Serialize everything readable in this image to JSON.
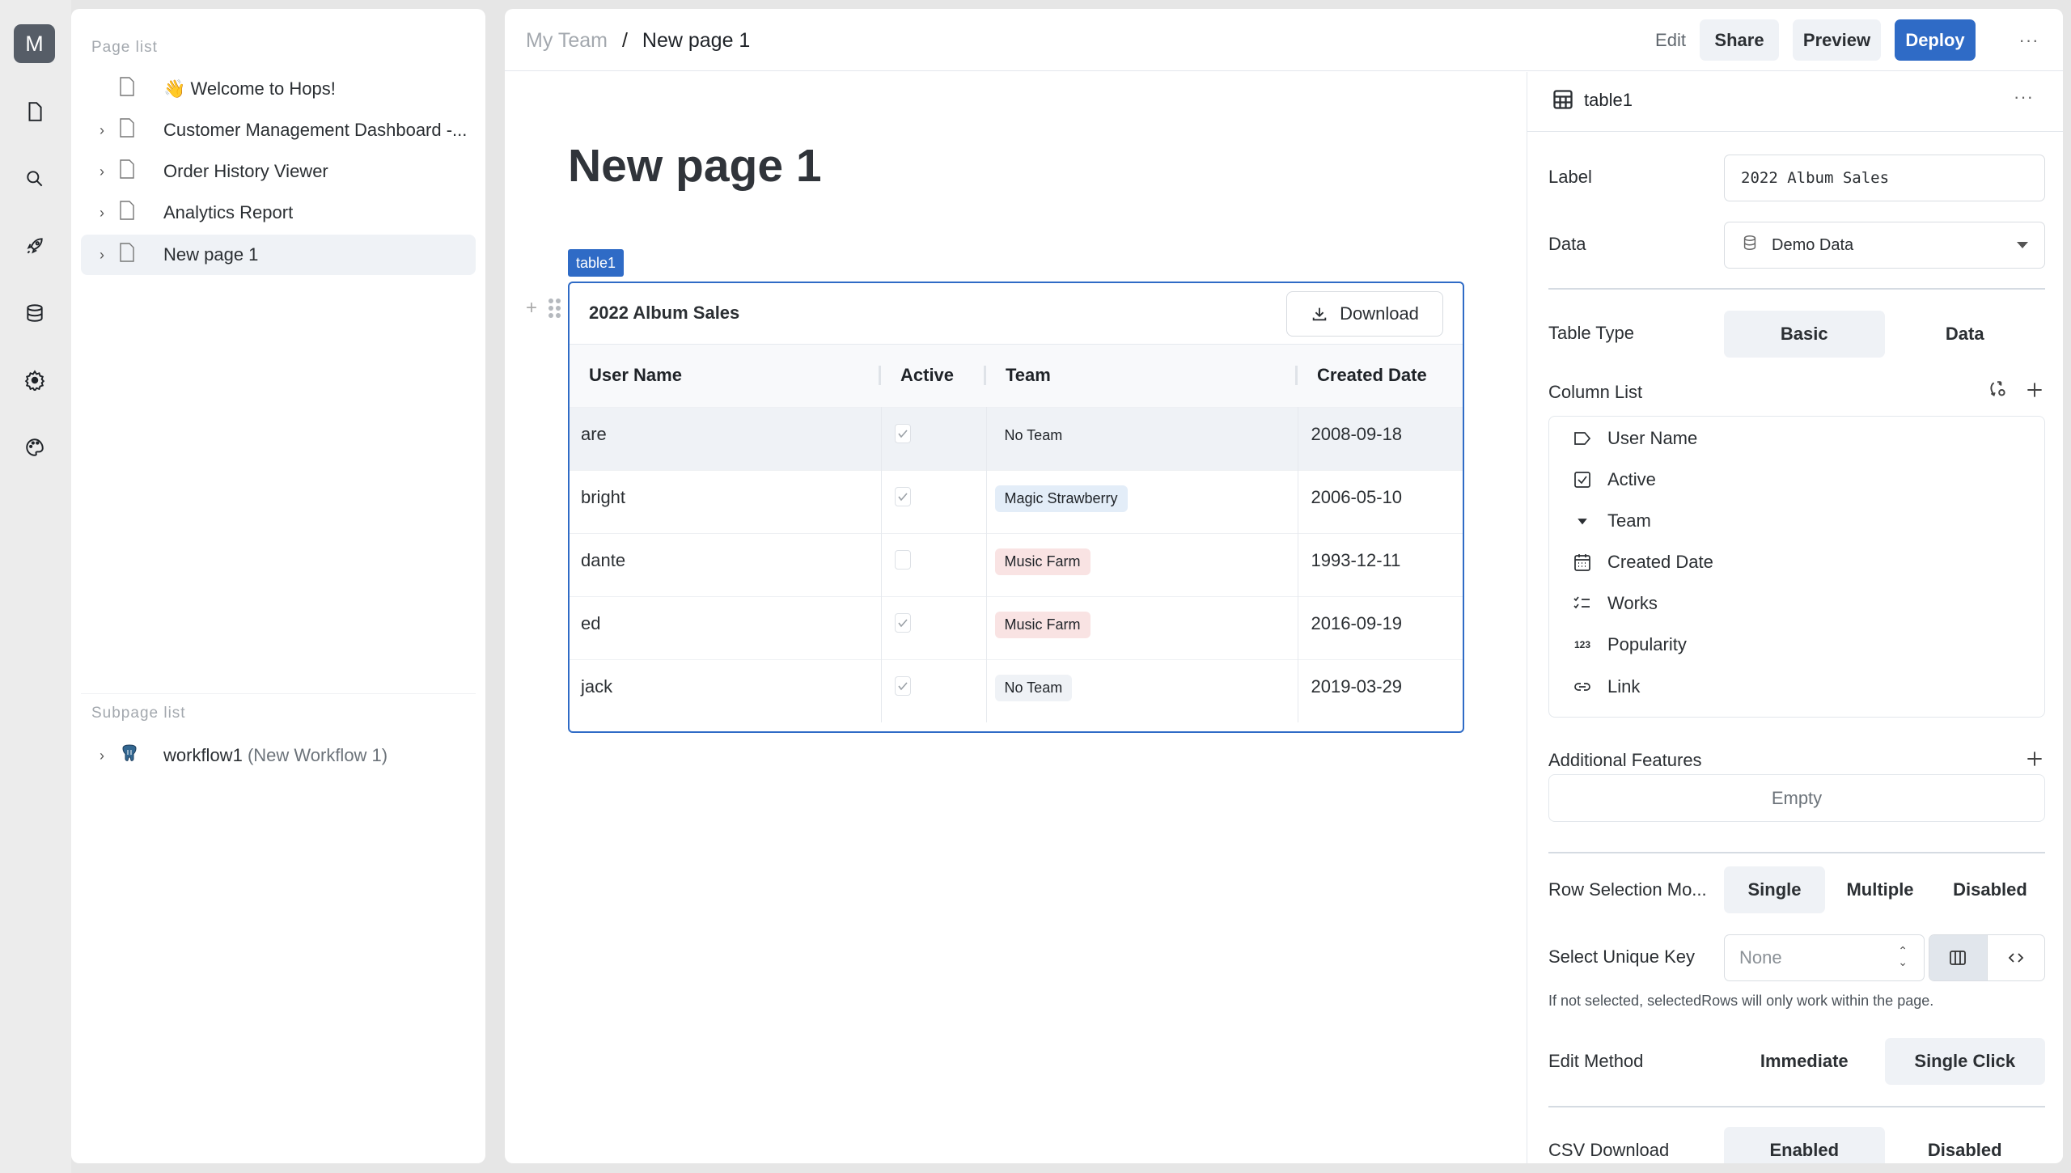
{
  "rail": {
    "avatar": "M",
    "icons": [
      "page-icon",
      "search-icon",
      "rocket-icon",
      "database-icon",
      "gear-icon",
      "palette-icon"
    ]
  },
  "page_list": {
    "heading": "Page list",
    "items": [
      {
        "label": "👋 Welcome to Hops!",
        "expandable": false,
        "active": false
      },
      {
        "label": "Customer Management Dashboard -...",
        "expandable": true,
        "active": false
      },
      {
        "label": "Order History Viewer",
        "expandable": true,
        "active": false
      },
      {
        "label": "Analytics Report",
        "expandable": true,
        "active": false
      },
      {
        "label": "New page 1",
        "expandable": true,
        "active": true
      }
    ],
    "subpage_heading": "Subpage list",
    "subpages": [
      {
        "name": "workflow1",
        "detail": "(New Workflow 1)"
      }
    ]
  },
  "header": {
    "breadcrumb": {
      "team": "My Team",
      "separator": "/",
      "page": "New page 1"
    },
    "edit": "Edit",
    "share": "Share",
    "preview": "Preview",
    "deploy": "Deploy",
    "more": "···"
  },
  "canvas": {
    "page_title": "New page 1",
    "component_tag": "table1",
    "table": {
      "title": "2022 Album Sales",
      "download_label": "Download",
      "columns": [
        "User Name",
        "Active",
        "Team",
        "Created Date"
      ],
      "rows": [
        {
          "user": "are",
          "active": true,
          "team": "No Team",
          "team_color": "#eff2f6",
          "date": "2008-09-18"
        },
        {
          "user": "bright",
          "active": true,
          "team": "Magic Strawberry",
          "team_color": "#e3edf8",
          "date": "2006-05-10"
        },
        {
          "user": "dante",
          "active": false,
          "team": "Music Farm",
          "team_color": "#f9e3e3",
          "date": "1993-12-11"
        },
        {
          "user": "ed",
          "active": true,
          "team": "Music Farm",
          "team_color": "#f9e3e3",
          "date": "2016-09-19"
        },
        {
          "user": "jack",
          "active": true,
          "team": "No Team",
          "team_color": "#eff2f6",
          "date": "2019-03-29"
        }
      ]
    }
  },
  "props": {
    "component_name": "table1",
    "more": "···",
    "label_label": "Label",
    "label_value": "2022 Album Sales",
    "data_label": "Data",
    "data_value": "Demo Data",
    "table_type_label": "Table Type",
    "table_type_options": [
      "Basic",
      "Data"
    ],
    "table_type_selected": "Basic",
    "column_list_label": "Column List",
    "columns": [
      {
        "label": "User Name",
        "icon": "tag-icon"
      },
      {
        "label": "Active",
        "icon": "checkbox-icon"
      },
      {
        "label": "Team",
        "icon": "dropdown-icon"
      },
      {
        "label": "Created Date",
        "icon": "calendar-icon"
      },
      {
        "label": "Works",
        "icon": "checklist-icon"
      },
      {
        "label": "Popularity",
        "icon": "number-icon"
      },
      {
        "label": "Link",
        "icon": "link-icon"
      }
    ],
    "additional_features_label": "Additional Features",
    "additional_features_empty": "Empty",
    "row_selection_label": "Row Selection Mo...",
    "row_selection_options": [
      "Single",
      "Multiple",
      "Disabled"
    ],
    "row_selection_selected": "Single",
    "unique_key_label": "Select Unique Key",
    "unique_key_placeholder": "None",
    "unique_key_hint": "If not selected, selectedRows will only work within the page.",
    "edit_method_label": "Edit Method",
    "edit_method_options": [
      "Immediate",
      "Single Click"
    ],
    "edit_method_selected": "Single Click",
    "csv_download_label": "CSV Download",
    "csv_download_options": [
      "Enabled",
      "Disabled"
    ],
    "csv_download_selected": "Enabled"
  },
  "colors": {
    "accent": "#2f6bc6",
    "selected_bg": "#eff2f6",
    "avatar_bg": "#565d67"
  }
}
